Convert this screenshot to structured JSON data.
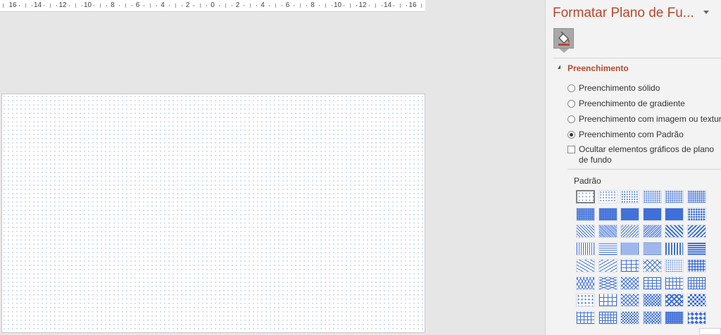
{
  "ruler": {
    "labels": [
      "16",
      "14",
      "12",
      "10",
      "8",
      "6",
      "4",
      "2",
      "0",
      "2",
      "4",
      "6",
      "8",
      "10",
      "12",
      "14",
      "16"
    ]
  },
  "pane": {
    "title": "Formatar Plano de Fu...",
    "section_header": "Preenchimento",
    "options": [
      {
        "label": "Preenchimento sólido",
        "checked": false
      },
      {
        "label": "Preenchimento de gradiente",
        "checked": false
      },
      {
        "label": "Preenchimento com imagem ou textura",
        "checked": false
      },
      {
        "label": "Preenchimento com Padrão",
        "checked": true
      }
    ],
    "hide_graphics_label": "Ocultar elementos gráficos de plano de fundo",
    "pattern_label": "Padrão",
    "selected_pattern_index": 0
  },
  "colors": {
    "accent": "#b8472d",
    "pattern": "#3f6fd8"
  },
  "icons": {
    "fill_tab": "paint-bucket-icon",
    "pane_menu": "chevron-down-icon"
  }
}
